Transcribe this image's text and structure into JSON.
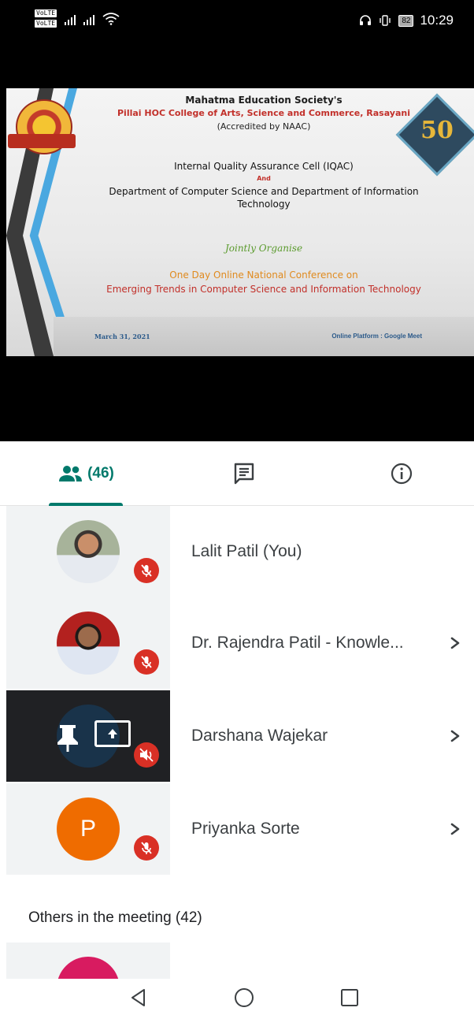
{
  "status_bar": {
    "network_badges": [
      "VoLTE",
      "VoLTE"
    ],
    "time": "10:29",
    "battery": "82"
  },
  "slide": {
    "society": "Mahatma Education Society's",
    "college": "Pillai HOC College of Arts, Science and Commerce, Rasayani",
    "accreditation": "(Accredited by NAAC)",
    "iqac": "Internal Quality Assurance Cell (IQAC)",
    "and": "And",
    "department": "Department of Computer Science and Department of Information Technology",
    "jointly": "Jointly Organise",
    "conference": "One Day Online National Conference on",
    "theme": "Emerging Trends in Computer Science and Information Technology",
    "date": "March 31, 2021",
    "platform": "Online Platform : Google Meet",
    "anniversary_number": "50"
  },
  "tabs": {
    "people_count": "(46)",
    "people_icon": "people-icon",
    "chat_icon": "chat-icon",
    "info_icon": "info-icon",
    "accent_color": "#00796b"
  },
  "participants": [
    {
      "name": "Lalit Patil (You)",
      "avatar": "photo",
      "muted": true
    },
    {
      "name": "Dr. Rajendra Patil - Knowle...",
      "avatar": "photo",
      "muted": true
    },
    {
      "name": "Darshana Wajekar",
      "avatar": "presenting",
      "muted": true
    },
    {
      "name": "Priyanka Sorte",
      "avatar_letter": "P",
      "muted": true
    }
  ],
  "others_heading": "Others in the meeting (42)",
  "colors": {
    "mute_red": "#d93025",
    "avatar_orange": "#ef6c00",
    "avatar_pink": "#d81b60"
  }
}
